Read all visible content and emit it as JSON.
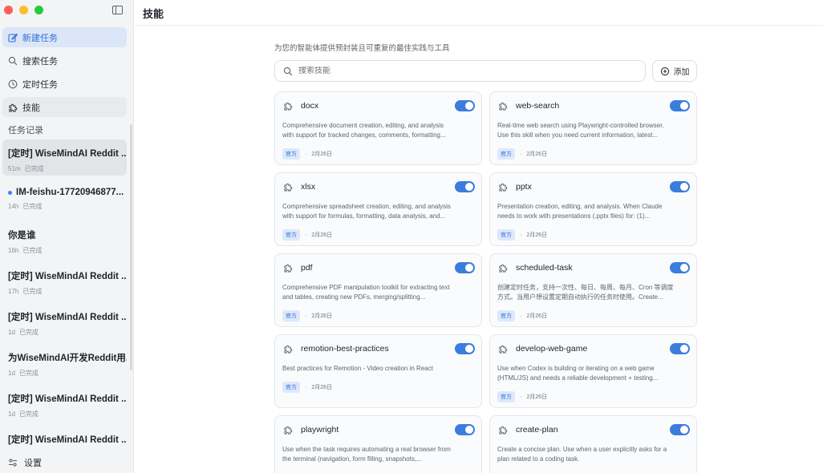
{
  "sidebar": {
    "nav": [
      {
        "label": "新建任务",
        "icon": "edit-icon"
      },
      {
        "label": "搜索任务",
        "icon": "search-icon"
      },
      {
        "label": "定时任务",
        "icon": "clock-icon"
      },
      {
        "label": "技能",
        "icon": "puzzle-icon"
      }
    ],
    "history_title": "任务记录",
    "history": [
      {
        "title": "[定时] WiseMindAI Reddit ...",
        "age": "51m",
        "status": "已完成"
      },
      {
        "title": "IM-feishu-17720946877...",
        "age": "14h",
        "status": "已完成"
      },
      {
        "title": "你是谁",
        "age": "16h",
        "status": "已完成"
      },
      {
        "title": "[定时] WiseMindAI Reddit ...",
        "age": "17h",
        "status": "已完成"
      },
      {
        "title": "[定时] WiseMindAI Reddit ...",
        "age": "1d",
        "status": "已完成"
      },
      {
        "title": "为WiseMindAI开发Reddit用...",
        "age": "1d",
        "status": "已完成"
      },
      {
        "title": "[定时] WiseMindAI Reddit ...",
        "age": "1d",
        "status": "已完成"
      },
      {
        "title": "[定时] WiseMindAI Reddit ..."
      }
    ],
    "settings_label": "设置"
  },
  "main": {
    "title": "技能",
    "subtitle": "为您的智能体提供预封装且可重复的最佳实践与工具",
    "search_placeholder": "搜索技能",
    "add_label": "添加"
  },
  "skills": [
    {
      "name": "docx",
      "desc1": "Comprehensive document creation, editing, and analysis",
      "desc2": "with support for tracked changes, comments, formatting...",
      "badge": "官方",
      "date": "2月26日",
      "enabled": true
    },
    {
      "name": "web-search",
      "desc1": "Real-time web search using Playwright-controlled browser.",
      "desc2": "Use this skill when you need current information, latest...",
      "badge": "官方",
      "date": "2月26日",
      "enabled": true
    },
    {
      "name": "xlsx",
      "desc1": "Comprehensive spreadsheet creation, editing, and analysis",
      "desc2": "with support for formulas, formatting, data analysis, and...",
      "badge": "官方",
      "date": "2月26日",
      "enabled": true
    },
    {
      "name": "pptx",
      "desc1": "Presentation creation, editing, and analysis. When Claude",
      "desc2": "needs to work with presentations (.pptx files) for: (1)...",
      "badge": "官方",
      "date": "2月26日",
      "enabled": true
    },
    {
      "name": "pdf",
      "desc1": "Comprehensive PDF manipulation toolkit for extracting text",
      "desc2": "and tables, creating new PDFs, merging/splitting...",
      "badge": "官方",
      "date": "2月26日",
      "enabled": true
    },
    {
      "name": "scheduled-task",
      "desc1": "创建定时任务，支持一次性、每日、每周、每月、Cron 等调度",
      "desc2": "方式。当用户想设置定期自动执行的任务时使用。Create...",
      "badge": "官方",
      "date": "2月26日",
      "enabled": true
    },
    {
      "name": "remotion-best-practices",
      "desc1": "Best practices for Remotion - Video creation in React",
      "desc2": "",
      "badge": "官方",
      "date": "2月26日",
      "enabled": true
    },
    {
      "name": "develop-web-game",
      "desc1": "Use when Codex is building or iterating on a web game",
      "desc2": "(HTML/JS) and needs a reliable development + testing...",
      "badge": "官方",
      "date": "2月26日",
      "enabled": true
    },
    {
      "name": "playwright",
      "desc1": "Use when the task requires automating a real browser from",
      "desc2": "the terminal (navigation, form filling, snapshots,...",
      "enabled": true
    },
    {
      "name": "create-plan",
      "desc1": "Create a concise plan. Use when a user explicitly asks for a",
      "desc2": "plan related to a coding task.",
      "enabled": true
    }
  ],
  "colors": {
    "accent": "#3b7ddd",
    "badge_bg": "#dde8fb",
    "sidebar_bg": "#f3f4f6"
  }
}
